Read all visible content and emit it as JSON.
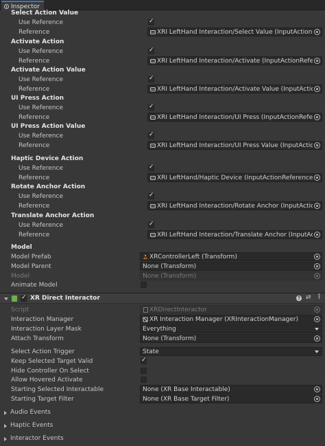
{
  "window": {
    "tab_title": "Inspector"
  },
  "actions": [
    {
      "name": "Select Action Value",
      "use_label": "Use Reference",
      "use_checked": true,
      "ref_label": "Reference",
      "ref_value": "XRI LeftHand Interaction/Select Value (InputActionReference)"
    },
    {
      "name": "Activate Action",
      "use_label": "Use Reference",
      "use_checked": true,
      "ref_label": "Reference",
      "ref_value": "XRI LeftHand Interaction/Activate (InputActionReference)"
    },
    {
      "name": "Activate Action Value",
      "use_label": "Use Reference",
      "use_checked": true,
      "ref_label": "Reference",
      "ref_value": "XRI LeftHand Interaction/Activate Value (InputActionReference)"
    },
    {
      "name": "UI Press Action",
      "use_label": "Use Reference",
      "use_checked": true,
      "ref_label": "Reference",
      "ref_value": "XRI LeftHand Interaction/UI Press (InputActionReference)"
    },
    {
      "name": "UI Press Action Value",
      "use_label": "Use Reference",
      "use_checked": true,
      "ref_label": "Reference",
      "ref_value": "XRI LeftHand Interaction/UI Press Value (InputActionReference)"
    },
    {
      "name": "Haptic Device Action",
      "use_label": "Use Reference",
      "use_checked": true,
      "ref_label": "Reference",
      "ref_value": "XRI LeftHand/Haptic Device (InputActionReference)"
    },
    {
      "name": "Rotate Anchor Action",
      "use_label": "Use Reference",
      "use_checked": true,
      "ref_label": "Reference",
      "ref_value": "XRI LeftHand Interaction/Rotate Anchor (InputActionReference)"
    },
    {
      "name": "Translate Anchor Action",
      "use_label": "Use Reference",
      "use_checked": true,
      "ref_label": "Reference",
      "ref_value": "XRI LeftHand Interaction/Translate Anchor (InputActionReference)"
    }
  ],
  "model": {
    "header": "Model",
    "prefab_label": "Model Prefab",
    "prefab_value": "XRControllerLeft (Transform)",
    "parent_label": "Model Parent",
    "parent_value": "None (Transform)",
    "model_label": "Model",
    "model_value": "None (Transform)",
    "animate_label": "Animate Model",
    "animate_checked": false
  },
  "component": {
    "title": "XR Direct Interactor",
    "enabled": true,
    "script_label": "Script",
    "script_value": "XRDirectInteractor",
    "manager_label": "Interaction Manager",
    "manager_value": "XR Interaction Manager (XRInteractionManager)",
    "layer_label": "Interaction Layer Mask",
    "layer_value": "Everything",
    "attach_label": "Attach Transform",
    "attach_value": "None (Transform)",
    "trigger_label": "Select Action Trigger",
    "trigger_value": "State",
    "keep_label": "Keep Selected Target Valid",
    "keep_checked": true,
    "hide_label": "Hide Controller On Select",
    "hide_checked": false,
    "hover_label": "Allow Hovered Activate",
    "hover_checked": false,
    "start_sel_label": "Starting Selected Interactable",
    "start_sel_value": "None (XR Base Interactable)",
    "start_filter_label": "Starting Target Filter",
    "start_filter_value": "None (XR Base Target Filter)"
  },
  "foldouts": [
    "Audio Events",
    "Haptic Events",
    "Interactor Events"
  ],
  "header_icons": [
    "help-icon",
    "preset-icon",
    "more-icon"
  ],
  "colors": {
    "background": "#383838",
    "field": "#2a2a2a",
    "tab_accent": "#3a79bb"
  }
}
